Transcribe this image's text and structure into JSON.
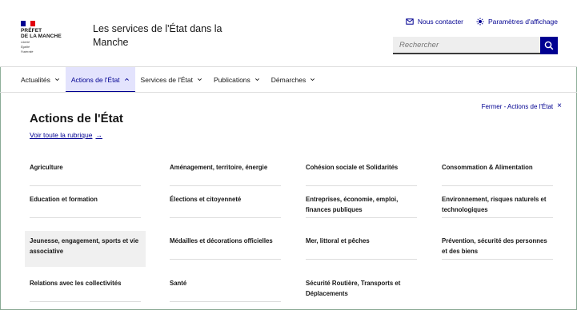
{
  "logo": {
    "lines": [
      "PRÉFET",
      "DE LA MANCHE"
    ],
    "motto": [
      "Liberté",
      "Égalité",
      "Fraternité"
    ],
    "colors": {
      "blue": "#000091",
      "red": "#e1000f"
    }
  },
  "header": {
    "service_title": "Les services de l'État dans la Manche",
    "contact_label": "Nous contacter",
    "contact_icon": "mail-icon",
    "display_label": "Paramètres d'affichage",
    "display_icon": "sun-gear-icon"
  },
  "search": {
    "placeholder": "Rechercher",
    "icon": "search-icon"
  },
  "nav": {
    "items": [
      {
        "label": "Actualités"
      },
      {
        "label": "Actions de l'État"
      },
      {
        "label": "Services de l'État"
      },
      {
        "label": "Publications"
      },
      {
        "label": "Démarches"
      }
    ],
    "active_index": 1
  },
  "panel": {
    "title": "Actions de l'État",
    "see_all": "Voir toute la rubrique",
    "close": "Fermer - Actions de l'État",
    "items": [
      "Agriculture",
      "Aménagement, territoire, énergie",
      "Cohésion sociale et Solidarités",
      "Consommation & Alimentation",
      "Education et formation",
      "Élections et citoyenneté",
      "Entreprises, économie, emploi, finances publiques",
      "Environnement, risques naturels et technologiques",
      "Jeunesse, engagement, sports et vie associative",
      "Médailles et décorations officielles",
      "Mer, littoral et pêches",
      "Prévention, sécurité des personnes et des biens",
      "Relations avec les collectivités",
      "Santé",
      "Sécurité Routière, Transports et Déplacements"
    ],
    "highlighted": "Jeunesse, engagement, sports et vie associative"
  },
  "colors": {
    "accent": "#000091",
    "active_bg": "#e3e3fd",
    "text": "#161616"
  }
}
